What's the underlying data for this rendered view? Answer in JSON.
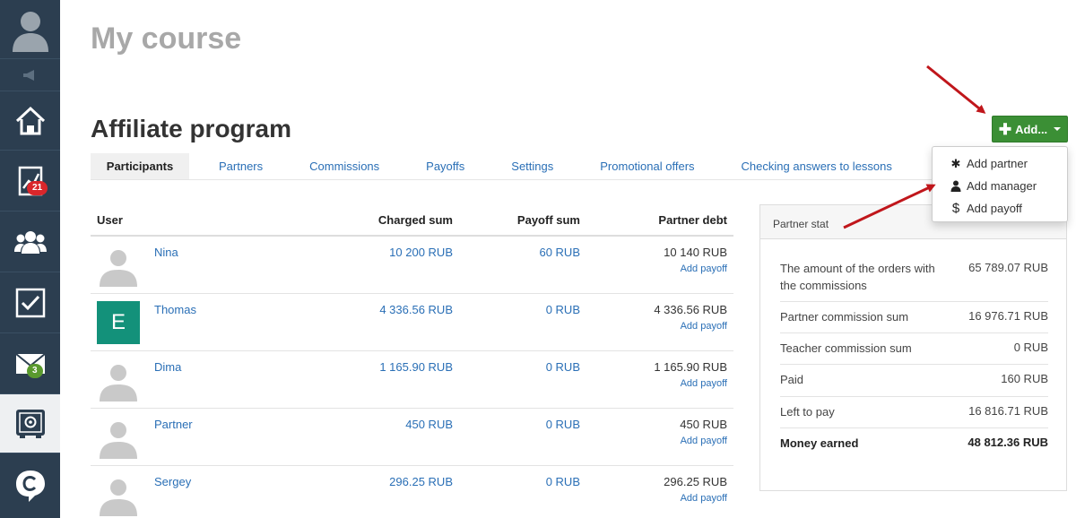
{
  "sidebar": {
    "items": [
      {
        "icon": "user-avatar-icon"
      },
      {
        "icon": "megaphone-icon"
      },
      {
        "icon": "home-icon"
      },
      {
        "icon": "chart-icon",
        "badge": "21"
      },
      {
        "icon": "users-icon"
      },
      {
        "icon": "checkbox-icon"
      },
      {
        "icon": "mail-icon",
        "badge": "3"
      },
      {
        "icon": "safe-icon"
      },
      {
        "icon": "brand-logo-icon"
      }
    ]
  },
  "header": {
    "course_title": "My course",
    "section_title": "Affiliate program"
  },
  "tabs": [
    "Participants",
    "Partners",
    "Commissions",
    "Payoffs",
    "Settings",
    "Promotional offers",
    "Checking answers to lessons"
  ],
  "table": {
    "headers": {
      "user": "User",
      "charged": "Charged sum",
      "payoff": "Payoff sum",
      "debt": "Partner debt"
    },
    "add_payoff_label": "Add payoff",
    "rows": [
      {
        "name": "Nina",
        "avatar": "default",
        "charged": "10 200 RUB",
        "payoff": "60 RUB",
        "debt": "10 140 RUB"
      },
      {
        "name": "Thomas",
        "avatar": "letter",
        "letter": "E",
        "charged": "4 336.56 RUB",
        "payoff": "0 RUB",
        "debt": "4 336.56 RUB"
      },
      {
        "name": "Dima",
        "avatar": "default",
        "charged": "1 165.90 RUB",
        "payoff": "0 RUB",
        "debt": "1 165.90 RUB"
      },
      {
        "name": "Partner",
        "avatar": "default",
        "charged": "450 RUB",
        "payoff": "0 RUB",
        "debt": "450 RUB"
      },
      {
        "name": "Sergey",
        "avatar": "default",
        "charged": "296.25 RUB",
        "payoff": "0 RUB",
        "debt": "296.25 RUB"
      }
    ]
  },
  "partner_stat": {
    "title": "Partner stat",
    "rows": [
      {
        "label": "The amount of the orders with the commissions",
        "value": "65 789.07 RUB"
      },
      {
        "label": "Partner commission sum",
        "value": "16 976.71 RUB"
      },
      {
        "label": "Teacher commission sum",
        "value": "0 RUB"
      },
      {
        "label": "Paid",
        "value": "160 RUB"
      },
      {
        "label": "Left to pay",
        "value": "16 816.71 RUB"
      },
      {
        "label": "Money earned",
        "value": "48 812.36 RUB"
      }
    ]
  },
  "add_menu": {
    "button_label": "Add...",
    "items": [
      {
        "label": "Add partner",
        "icon": "asterisk-icon"
      },
      {
        "label": "Add manager",
        "icon": "person-icon"
      },
      {
        "label": "Add payoff",
        "icon": "dollar-icon"
      }
    ]
  },
  "colors": {
    "sidebar": "#2c3e50",
    "link": "#2a6fb6",
    "add_button": "#3b8f35",
    "annotation_arrow": "#c0161b",
    "badge_red": "#d9262b",
    "badge_green": "#5a9a2e",
    "letter_avatar": "#13917a"
  }
}
